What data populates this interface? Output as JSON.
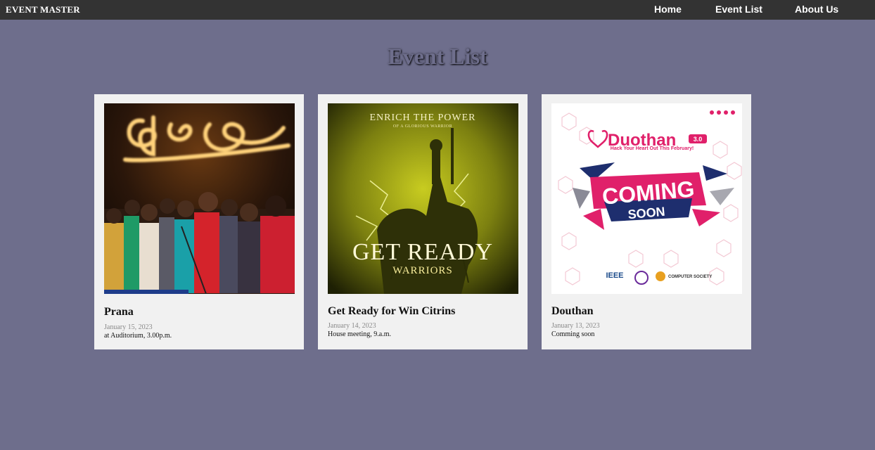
{
  "header": {
    "brand": "EVENT MASTER",
    "nav": [
      "Home",
      "Event List",
      "About Us"
    ]
  },
  "page": {
    "title": "Event List"
  },
  "events": [
    {
      "title": "Prana",
      "date": "January 15, 2023",
      "description": "at Auditorium, 3.00p.m.",
      "image_text": [
        "ප්‍රාණ"
      ]
    },
    {
      "title": "Get Ready for Win Citrins",
      "date": "January 14, 2023",
      "description": "House meeting, 9.a.m.",
      "image_text": [
        "ENRICH THE POWER",
        "OF A GLORIOUS WARRIOR",
        "GET READY",
        "WARRIORS"
      ]
    },
    {
      "title": "Douthan",
      "date": "January 13, 2023",
      "description": "Comming soon",
      "image_text": [
        "Duothan",
        "3.0",
        "Hack Your Heart Out This February!",
        "COMING",
        "SOON",
        "IEEE",
        "COMPUTER SOCIETY"
      ]
    }
  ],
  "colors": {
    "background": "#6e6e8c",
    "navbar": "#333333",
    "card": "#f1f1f1",
    "brand_pink": "#e0206a",
    "navy": "#1e2e6e",
    "olive": "#a8ad10"
  }
}
